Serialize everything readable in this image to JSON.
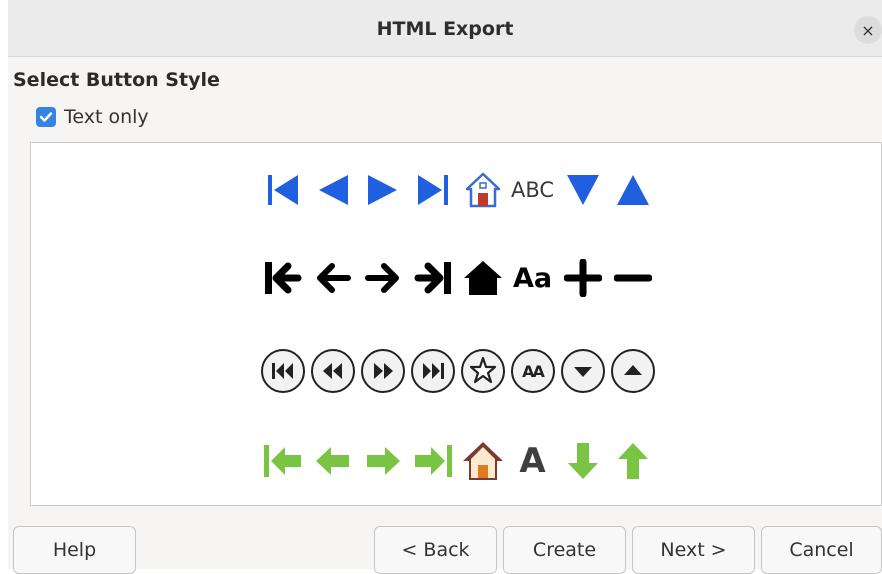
{
  "window": {
    "title": "HTML Export",
    "close_symbol": "×"
  },
  "section": {
    "title": "Select Button Style"
  },
  "option": {
    "label": "Text only",
    "checked": true
  },
  "button_styles": [
    {
      "name": "blue-triangles",
      "icons": [
        "first-page-icon",
        "previous-page-icon",
        "next-page-icon",
        "last-page-icon",
        "home-icon",
        "text-icon",
        "expand-icon",
        "collapse-icon"
      ],
      "text_glyph": "ABC"
    },
    {
      "name": "black-arrows",
      "icons": [
        "first-page-icon",
        "previous-page-icon",
        "next-page-icon",
        "last-page-icon",
        "home-icon",
        "text-icon",
        "expand-icon",
        "collapse-icon"
      ],
      "text_glyph": "Aa"
    },
    {
      "name": "round-buttons",
      "icons": [
        "first-page-icon",
        "previous-page-icon",
        "next-page-icon",
        "last-page-icon",
        "star-icon",
        "text-icon",
        "down-icon",
        "up-icon"
      ],
      "text_glyph": "AA"
    },
    {
      "name": "green-arrows",
      "icons": [
        "first-page-icon",
        "previous-page-icon",
        "next-page-icon",
        "last-page-icon",
        "home-icon",
        "text-icon",
        "down-icon",
        "up-icon"
      ],
      "text_glyph": "A"
    }
  ],
  "buttons": {
    "help": "Help",
    "back": "< Back",
    "create": "Create",
    "next": "Next >",
    "cancel": "Cancel"
  },
  "colors": {
    "accent": "#3584e4",
    "blue_icon": "#1f5fe0",
    "green_icon": "#79c442",
    "house_brown": "#7a3b2e"
  }
}
